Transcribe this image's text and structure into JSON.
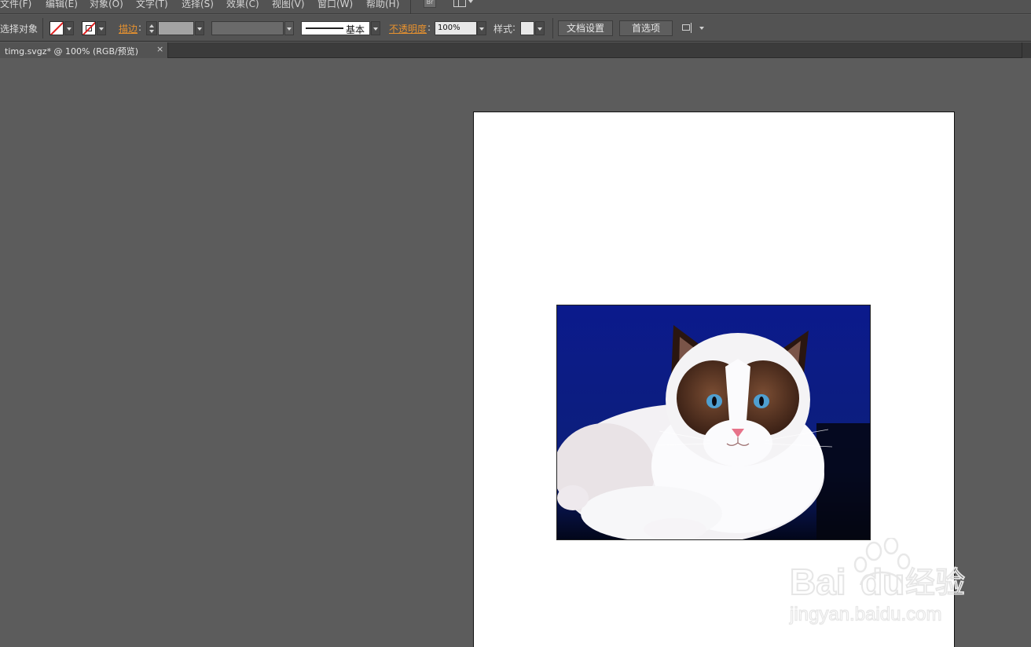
{
  "menu": {
    "items": [
      "文件(F)",
      "编辑(E)",
      "对象(O)",
      "文字(T)",
      "选择(S)",
      "效果(C)",
      "视图(V)",
      "窗口(W)",
      "帮助(H)"
    ],
    "bridge_label": "Br"
  },
  "control_bar": {
    "selection_label": "未选择对象",
    "stroke_label": "描边",
    "brush_label": "基本",
    "opacity_label": "不透明度",
    "opacity_value": "100%",
    "style_label": "样式",
    "document_setup_button": "文档设置",
    "preferences_button": "首选项"
  },
  "document_tab": {
    "title": "timg.svgz* @ 100% (RGB/预览)",
    "close": "×"
  },
  "watermark": {
    "brand": "Bai du 经验",
    "url": "jingyan.baidu.com"
  },
  "colors": {
    "ui_panel": "#535353",
    "canvas": "#5c5c5c",
    "accent_orange": "#e8922f",
    "none_slash": "#e02020",
    "artboard": "#ffffff",
    "photo_background": "#0d1c8a"
  },
  "icons": [
    "fill-none-icon",
    "stroke-none-icon",
    "bridge-icon",
    "workspace-icon",
    "pin-icon",
    "close-icon"
  ]
}
